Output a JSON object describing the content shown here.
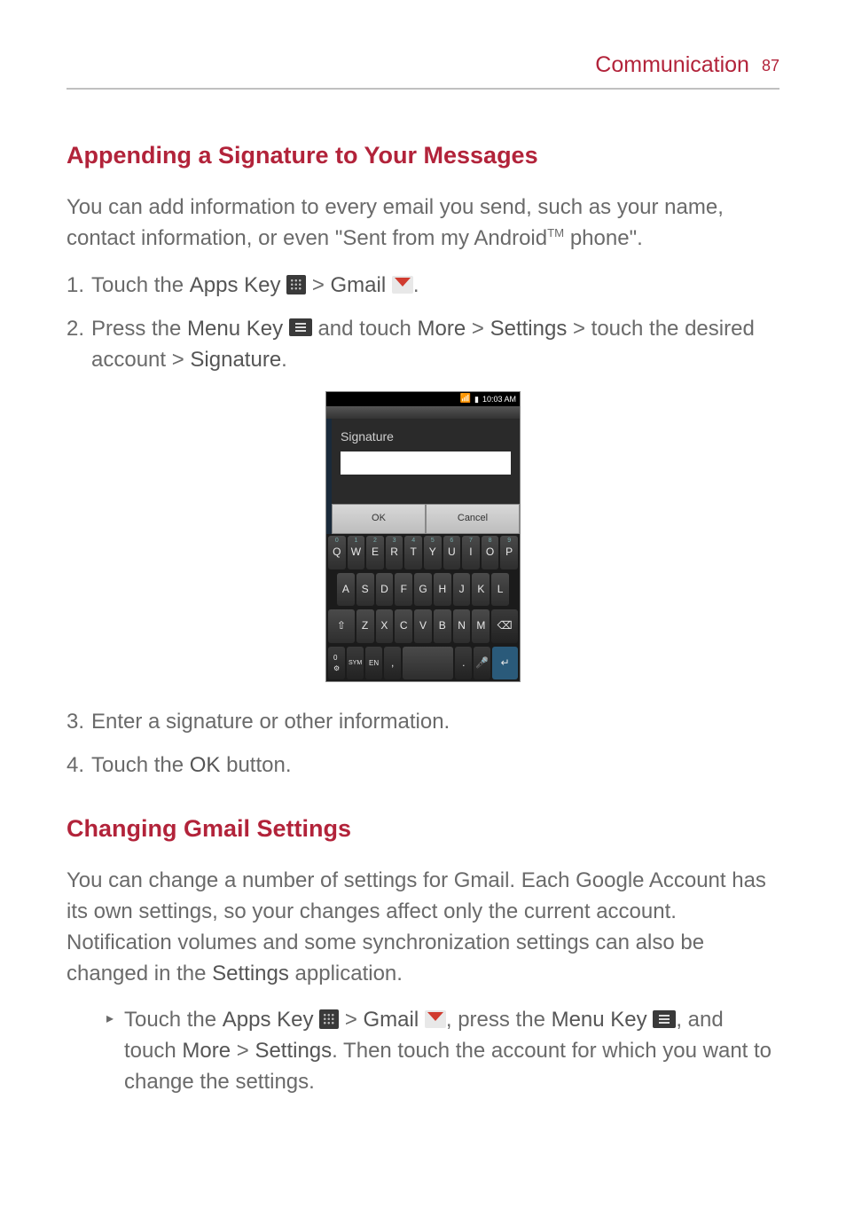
{
  "header": {
    "title": "Communication",
    "page": "87"
  },
  "section1": {
    "title": "Appending a Signature to Your Messages",
    "intro_a": "You can add information to every email you send, such as your name, contact information, or even \"Sent from my Android",
    "intro_tm": "TM",
    "intro_b": " phone\".",
    "step1_num": "1.",
    "step1_a": "Touch the ",
    "step1_apps": "Apps Key",
    "step1_b": " > ",
    "step1_gmail": "Gmail",
    "step1_c": ".",
    "step2_num": "2.",
    "step2_a": "Press the ",
    "step2_menu": "Menu Key",
    "step2_b": " and touch ",
    "step2_more": "More",
    "step2_c": " > ",
    "step2_settings": "Settings",
    "step2_d": " > touch the desired account > ",
    "step2_sig": "Signature",
    "step2_e": ".",
    "step3_num": "3.",
    "step3": "Enter a signature or other information.",
    "step4_num": "4.",
    "step4_a": "Touch the ",
    "step4_ok": "OK",
    "step4_b": " button."
  },
  "phone": {
    "time": "10:03 AM",
    "sig_label": "Signature",
    "ok": "OK",
    "cancel": "Cancel",
    "row1": [
      "Q",
      "W",
      "E",
      "R",
      "T",
      "Y",
      "U",
      "I",
      "O",
      "P"
    ],
    "row1_alt": [
      "0",
      "1",
      "2",
      "3",
      "4",
      "5",
      "6",
      "7",
      "8",
      "9"
    ],
    "row2": [
      "A",
      "S",
      "D",
      "F",
      "G",
      "H",
      "J",
      "K",
      "L"
    ],
    "row3": [
      "Z",
      "X",
      "C",
      "V",
      "B",
      "N",
      "M"
    ],
    "shift": "⇧",
    "del": "⌫",
    "sym": "SYM",
    "en": "EN",
    "mic": "🎤",
    "enter": "↵"
  },
  "section2": {
    "title": "Changing Gmail Settings",
    "intro_a": "You can change a number of settings for Gmail. Each Google Account has its own settings, so your changes affect only the current account. Notification volumes and some synchronization settings can also be changed in the ",
    "intro_settings": "Settings",
    "intro_b": " application.",
    "bullet_marker": "▸",
    "bullet_a": "Touch the ",
    "bullet_apps": "Apps Key",
    "bullet_b": " > ",
    "bullet_gmail": "Gmail",
    "bullet_c": ", press the ",
    "bullet_menu": "Menu Key",
    "bullet_d": ", and touch ",
    "bullet_more": "More",
    "bullet_e": " > ",
    "bullet_settings": "Settings",
    "bullet_f": ". Then touch the account for which you want to change the settings."
  }
}
